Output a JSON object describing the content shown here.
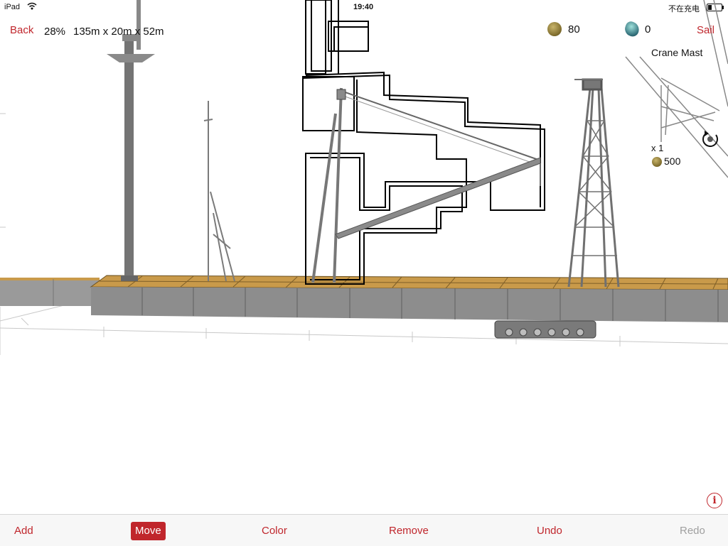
{
  "status_bar": {
    "carrier": "iPad",
    "time": "19:40",
    "charging": "不在充电",
    "battery_level": 0.3
  },
  "header": {
    "back_label": "Back",
    "zoom": "28%",
    "dimensions": "135m x 20m x 52m",
    "coins": "80",
    "gems": "0",
    "sail_label": "Sail"
  },
  "selected_part": {
    "name": "Crane Mast",
    "count": "x 1",
    "cost": "500",
    "icon": "rotate-icon"
  },
  "toolbar": {
    "add": "Add",
    "move": "Move",
    "color": "Color",
    "remove": "Remove",
    "undo": "Undo",
    "redo": "Redo"
  },
  "info_label": "i",
  "colors": {
    "accent": "#c0262c",
    "deck": "#c99a4a",
    "hull": "#8a8a8a",
    "structure": "#6f6f6f"
  }
}
